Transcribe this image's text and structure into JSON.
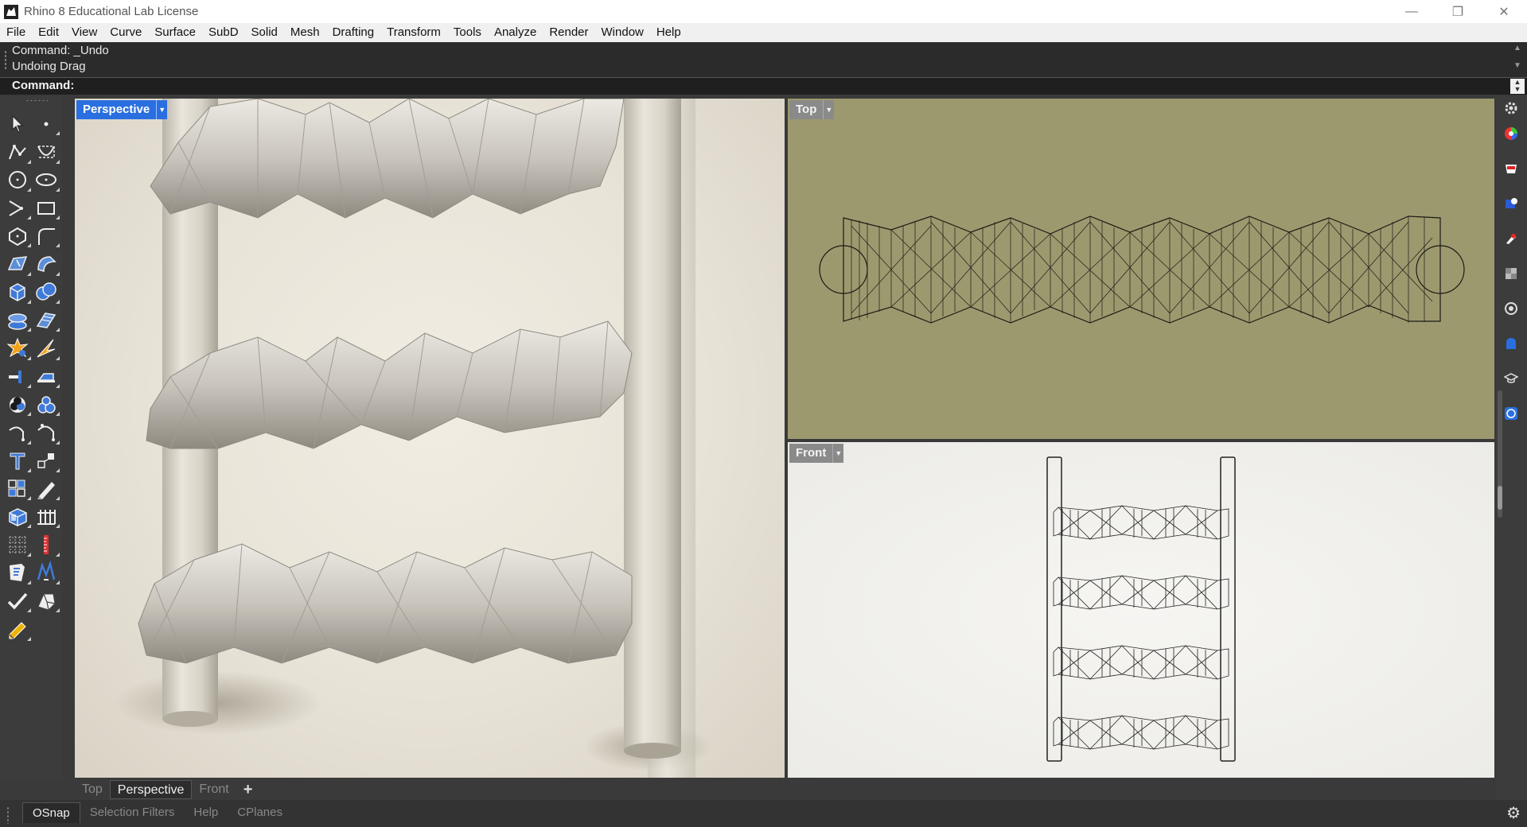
{
  "window": {
    "title": "Rhino 8 Educational Lab License",
    "minimize": "—",
    "restore": "❐",
    "close": "✕"
  },
  "menu": [
    "File",
    "Edit",
    "View",
    "Curve",
    "Surface",
    "SubD",
    "Solid",
    "Mesh",
    "Drafting",
    "Transform",
    "Tools",
    "Analyze",
    "Render",
    "Window",
    "Help"
  ],
  "command": {
    "history": [
      "Command: _Undo",
      "Undoing Drag"
    ],
    "prompt": "Command:"
  },
  "toolbar": {
    "icons": [
      "select-arrow-icon",
      "point-icon",
      "polyline-icon",
      "curve-control-points-icon",
      "circle-icon",
      "ellipse-icon",
      "polygon-curve-icon",
      "rectangle-icon",
      "polygon-icon",
      "fillet-curve-icon",
      "surface-from-points-icon",
      "sweep-surface-icon",
      "box-solid-icon",
      "boolean-union-icon",
      "cylinder-solid-icon",
      "extrude-surface-icon",
      "explode-icon",
      "trim-icon",
      "split-icon",
      "join-icon",
      "boolean-difference-icon",
      "boolean-split-icon",
      "rotate-curve-icon",
      "offset-curve-icon",
      "text-icon",
      "scale-icon",
      "array-icon",
      "dimension-icon",
      "block-icon",
      "grid-snap-icon",
      "mesh-icon",
      "measure-icon",
      "properties-icon",
      "render-mesh-icon",
      "check-icon",
      "solid-tools-icon",
      "pencil-icon"
    ]
  },
  "viewports": {
    "perspective": {
      "label": "Perspective"
    },
    "top": {
      "label": "Top"
    },
    "front": {
      "label": "Front"
    }
  },
  "viewport_tabs": [
    "Top",
    "Perspective",
    "Front"
  ],
  "viewport_tab_add": "+",
  "status_tabs": [
    "OSnap",
    "Selection Filters",
    "Help",
    "CPlanes"
  ],
  "colors": {
    "accent": "#2a6fe0",
    "top_viewport_bg": "#9d996f",
    "perspective_bg": "#e8e3d7"
  },
  "right_panel_icons": [
    "settings-gear-icon",
    "color-wheel-icon",
    "materials-icon",
    "layers-icon",
    "paintbrush-icon",
    "texture-icon",
    "camera-icon",
    "environment-icon",
    "help-teach-icon",
    "help-icon"
  ]
}
